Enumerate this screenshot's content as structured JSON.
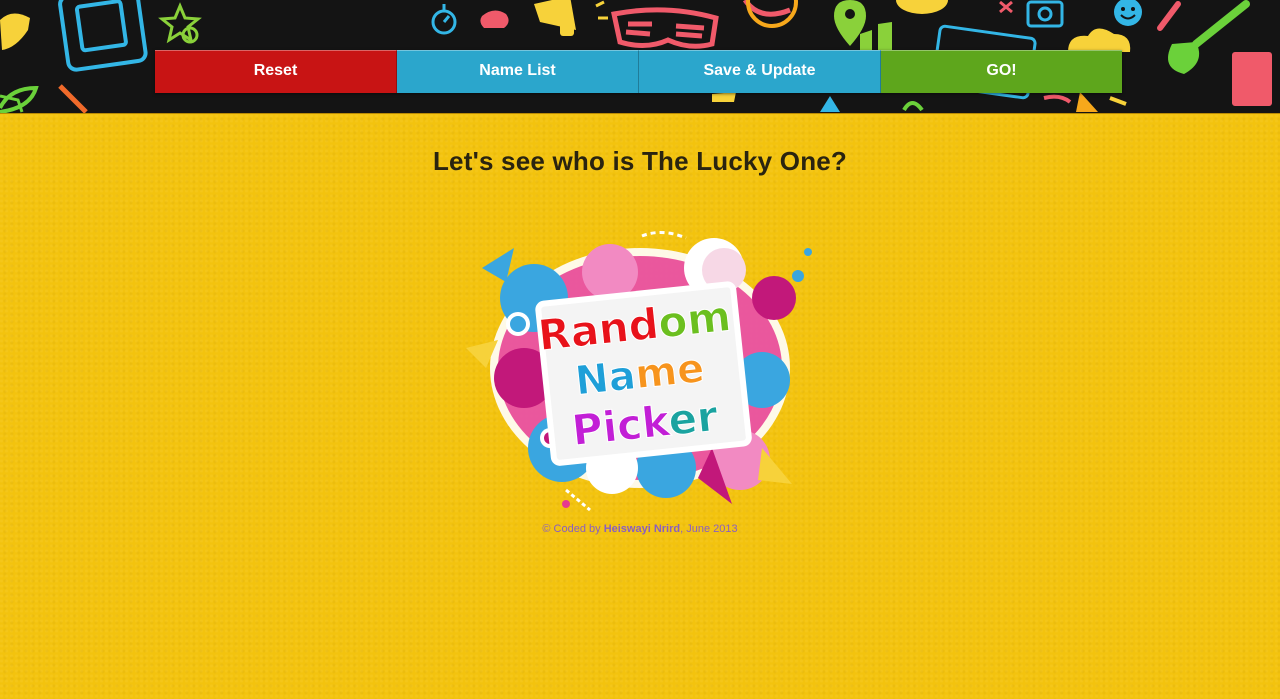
{
  "toolbar": {
    "buttons": [
      {
        "label": "Reset",
        "color": "#c81414"
      },
      {
        "label": "Name List",
        "color": "#2ba6cc"
      },
      {
        "label": "Save & Update",
        "color": "#2ba6cc"
      },
      {
        "label": "GO!",
        "color": "#5ea61c"
      }
    ]
  },
  "main": {
    "title": "Let's see who is The Lucky One?"
  },
  "logo": {
    "line1": [
      "R",
      "a",
      "n",
      "d",
      "o",
      "m"
    ],
    "line2": [
      "N",
      "a",
      "m",
      "e"
    ],
    "line3": [
      "P",
      "i",
      "c",
      "k",
      "e",
      "r"
    ]
  },
  "footer": {
    "prefix": "© Coded by ",
    "author": "Heiswayi Nrird",
    "suffix": ", June 2013"
  },
  "colors": {
    "page_bg": "#f3c30e",
    "banner_bg": "#141414"
  }
}
